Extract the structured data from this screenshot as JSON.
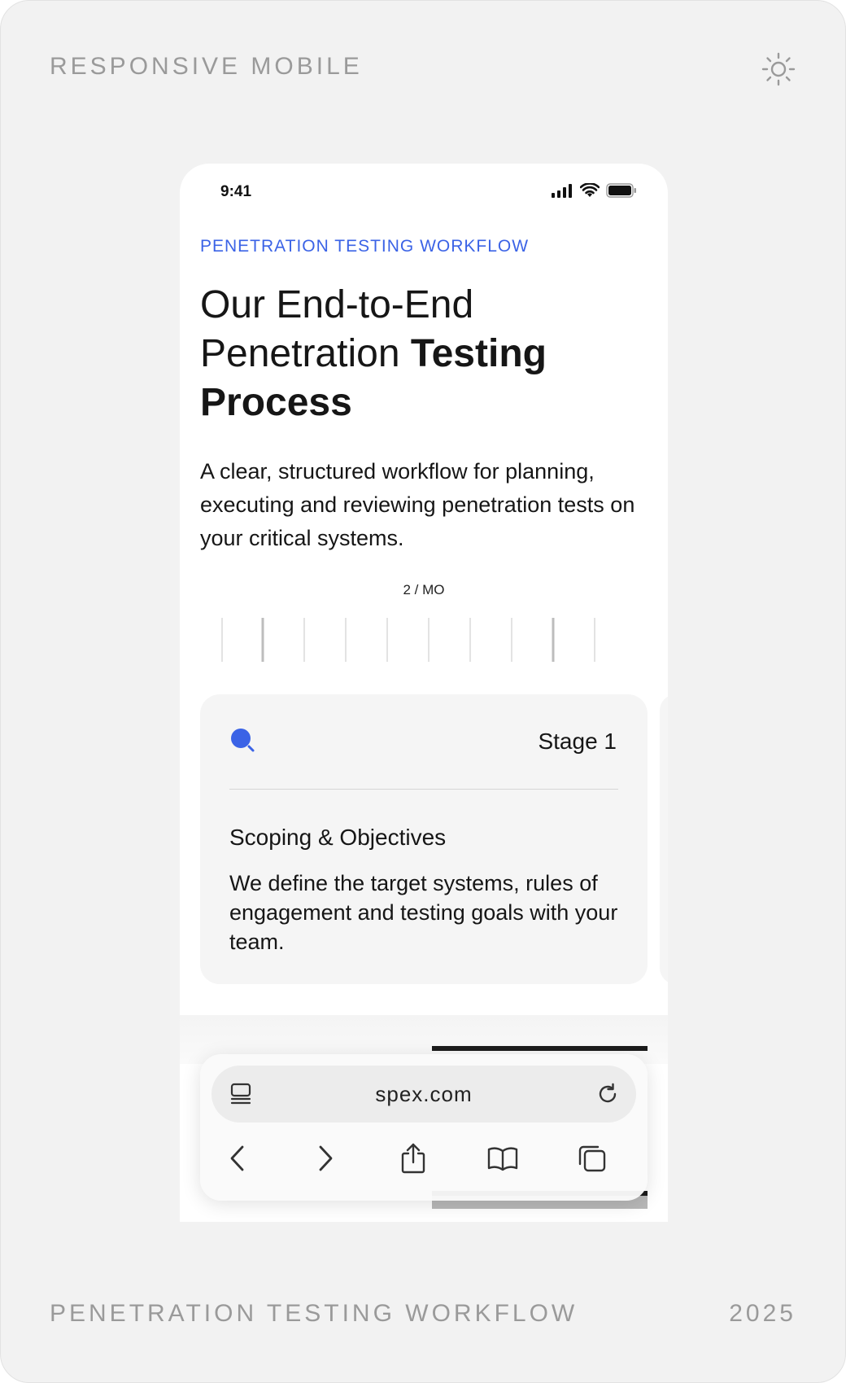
{
  "frame": {
    "top_label": "RESPONSIVE MOBILE",
    "bottom_label": "PENETRATION TESTING WORKFLOW",
    "year": "2025"
  },
  "status_bar": {
    "time": "9:41"
  },
  "hero": {
    "kicker": "PENETRATION TESTING WORKFLOW",
    "headline_regular": "Our End-to-End Penetration ",
    "headline_bold": "Testing Process",
    "lede": "A clear, structured workflow for planning, executing and reviewing penetration tests on your critical systems."
  },
  "pager": {
    "rate": "2 / MO"
  },
  "stage": {
    "label": "Stage 1",
    "title": "Scoping & Objectives",
    "description": "We define the target systems, rules of engagement and testing goals with your team.",
    "icon": "search-icon",
    "accent": "#3b63e6"
  },
  "browser": {
    "url": "spex.com",
    "icons": [
      "tabs-icon",
      "reload-icon",
      "back-icon",
      "forward-icon",
      "share-icon",
      "bookmarks-icon",
      "pages-icon"
    ]
  },
  "colors": {
    "accent": "#3b63e6",
    "text": "#161616",
    "muted": "#9a9a9a"
  }
}
